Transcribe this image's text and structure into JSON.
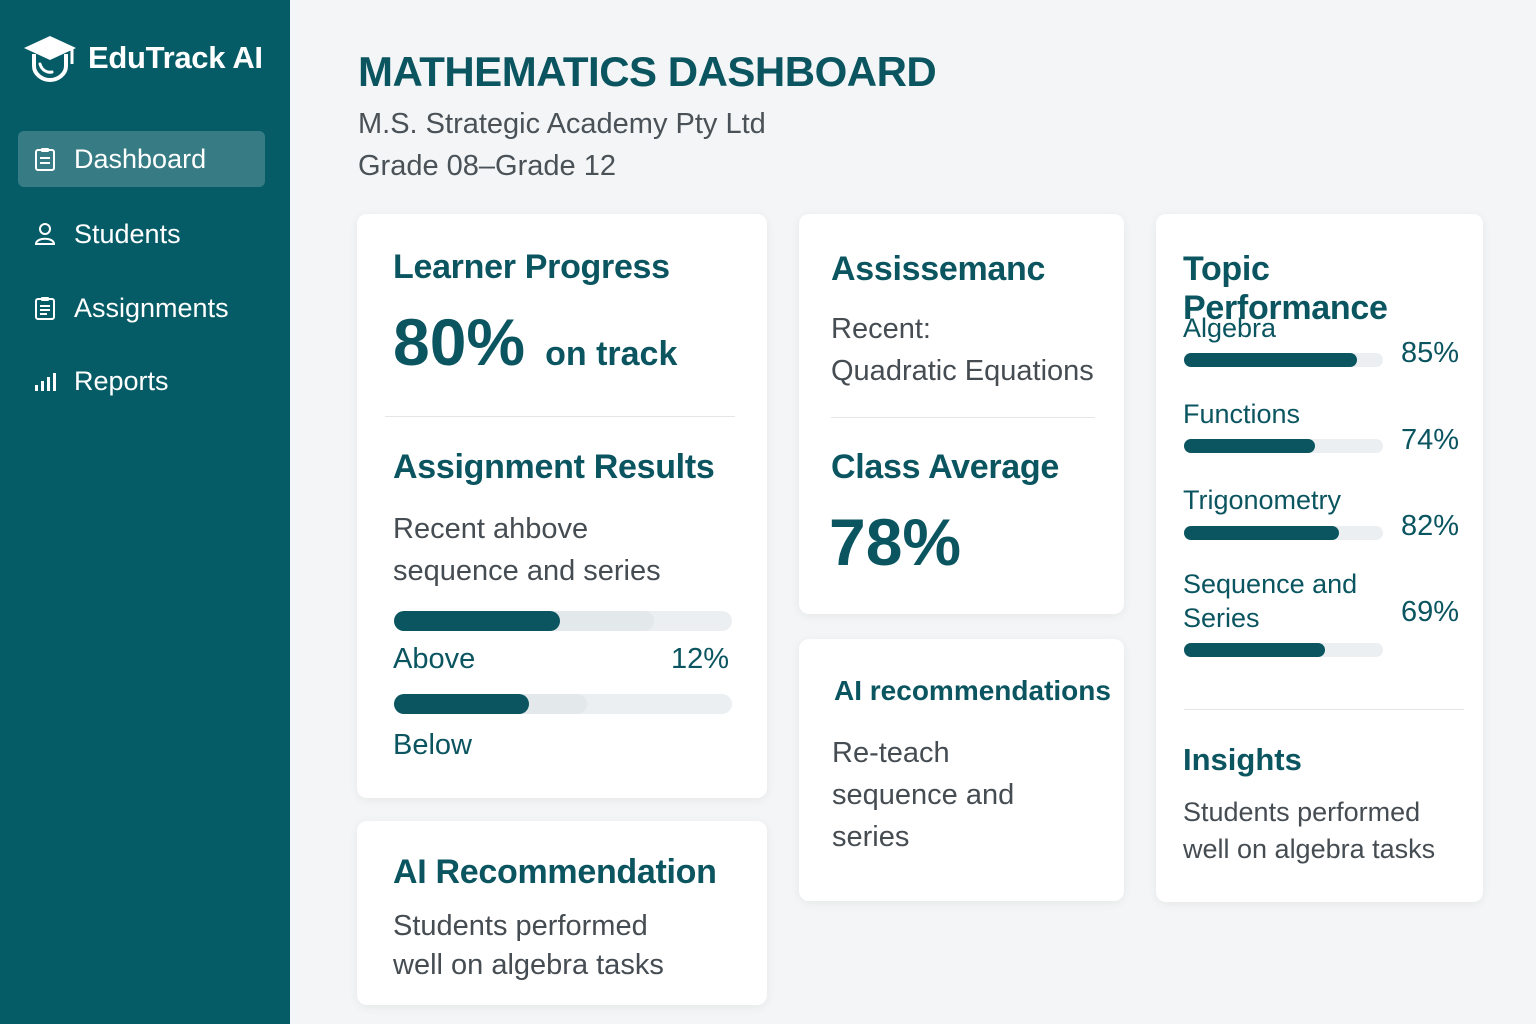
{
  "sidebar": {
    "brand": "EduTrack AI",
    "items": [
      {
        "label": "Dashboard",
        "icon": "clipboard-icon",
        "active": true
      },
      {
        "label": "Students",
        "icon": "user-icon",
        "active": false
      },
      {
        "label": "Assignments",
        "icon": "clipboard-list-icon",
        "active": false
      },
      {
        "label": "Reports",
        "icon": "bar-chart-icon",
        "active": false
      }
    ]
  },
  "header": {
    "title": "MATHEMATICS DASHBOARD",
    "school": "M.S. Strategic Academy Pty Ltd",
    "grades": "Grade 08–Grade 12"
  },
  "learner_progress": {
    "title": "Learner Progress",
    "value": "80%",
    "suffix": "on track"
  },
  "assignment_results": {
    "title": "Assignment Results",
    "line1": "Recent ahbove",
    "line2": "sequence and series",
    "above_label": "Above",
    "above_value": "12%",
    "above_bar": 0.49,
    "above_bar_secondary": 0.77,
    "below_label": "Below",
    "below_bar": 0.4,
    "below_bar_secondary": 0.57
  },
  "assessment": {
    "title": "Assissemanc",
    "recent_label": "Recent:",
    "recent_value": "Quadratic Equations"
  },
  "class_average": {
    "title": "Class Average",
    "value": "78%"
  },
  "ai_recs": {
    "title": "AI recommendations",
    "line1": "Re-teach",
    "line2": "sequence and",
    "line3": "series"
  },
  "ai_recommendation": {
    "title": "AI Recommendation",
    "line1": "Students performed",
    "line2": "well on algebra tasks"
  },
  "topic_performance": {
    "title": "Topic Performance",
    "topics": [
      {
        "name": "Algebra",
        "value": "85%",
        "fraction": 0.87
      },
      {
        "name": "Functions",
        "value": "74%",
        "fraction": 0.66
      },
      {
        "name": "Trigonometry",
        "value": "82%",
        "fraction": 0.78
      },
      {
        "name_line1": "Sequence and",
        "name_line2": "Series",
        "value": "69%",
        "fraction": 0.71
      }
    ]
  },
  "insights": {
    "title": "Insights",
    "line1": "Students performed",
    "line2": "well on algebra tasks"
  },
  "colors": {
    "sidebar": "#065c66",
    "accent": "#0b5560",
    "background": "#f3f5f6"
  }
}
